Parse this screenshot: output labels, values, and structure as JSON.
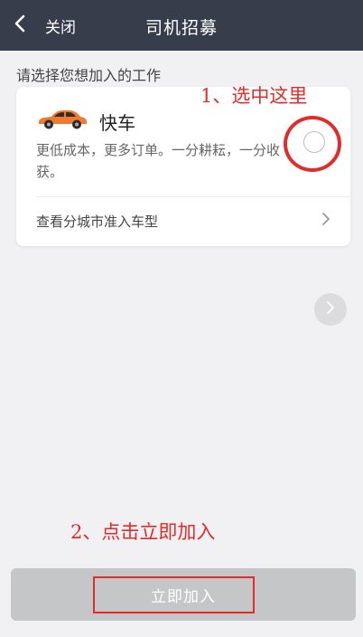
{
  "header": {
    "back_label": "关闭",
    "title": "司机招募",
    "background": "#383d4c"
  },
  "section": {
    "label": "请选择您想加入的工作"
  },
  "job_card": {
    "icon": "orange-car-icon",
    "title": "快车",
    "description": "更低成本，更多订单。一分耕耘，一分收获。",
    "selected": false,
    "city_link_label": "查看分城市准入车型"
  },
  "annotations": {
    "step1": "1、选中这里",
    "step2": "2、点击立即加入",
    "color": "#e32b2b"
  },
  "footer": {
    "join_label": "立即加入",
    "button_color": "#c5c6c8"
  }
}
